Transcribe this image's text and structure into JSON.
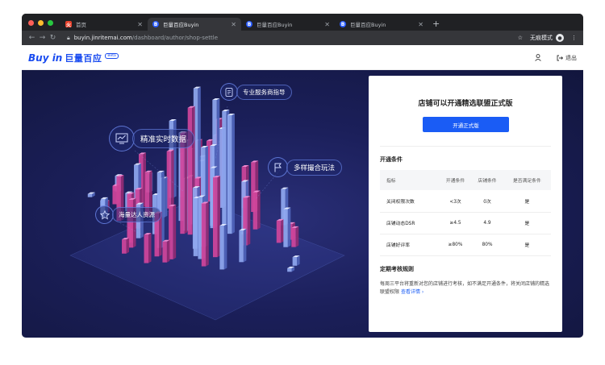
{
  "browser": {
    "tabs": [
      {
        "title": "首页",
        "favicon": "douyin-home-icon",
        "active": false
      },
      {
        "title": "巨量百应Buyin",
        "favicon": "buyin-icon",
        "active": true
      },
      {
        "title": "巨量百应Buyin",
        "favicon": "buyin-icon",
        "active": false
      },
      {
        "title": "巨量百应Buyin",
        "favicon": "buyin-icon",
        "active": false
      }
    ],
    "new_tab": "+",
    "url_host": "buyin.jinritemai.com",
    "url_path": "/dashboard/author/shop-settle",
    "incognito_label": "无痕模式"
  },
  "header": {
    "logo_en": "Buy in",
    "logo_cn": "巨量百应",
    "logo_badge": "Beta",
    "logout": "退出"
  },
  "hero": {
    "features": [
      {
        "label": "专业服务商指导",
        "icon": "document-icon"
      },
      {
        "label": "精准实时数据",
        "icon": "chart-icon"
      },
      {
        "label": "多样撮合玩法",
        "icon": "flag-icon"
      },
      {
        "label": "海量达人资源",
        "icon": "star-icon"
      }
    ]
  },
  "card": {
    "title": "店铺可以开通精选联盟正式版",
    "open_button": "开通正式版",
    "conditions_title": "开通条件",
    "table": {
      "headers": [
        "指标",
        "开通条件",
        "店铺条件",
        "是否满足条件"
      ],
      "rows": [
        [
          "关闭权限次数",
          "<3次",
          "0次",
          "是"
        ],
        [
          "店铺动态DSR",
          "≥4.5",
          "4.9",
          "是"
        ],
        [
          "店铺好评率",
          "≥80%",
          "80%",
          "是"
        ]
      ]
    },
    "rules_title": "定期考核规则",
    "rules_text": "每周三平台将重新对您的店铺进行考核，如不满足开通条件，将关闭店铺的精选联盟权限",
    "rules_link": "查看详情"
  },
  "colors": {
    "accent": "#1a5cf5",
    "hero_bg": "#1b1f5a",
    "bar_pink": "#d0459b",
    "bar_blue": "#8fa8f0"
  }
}
